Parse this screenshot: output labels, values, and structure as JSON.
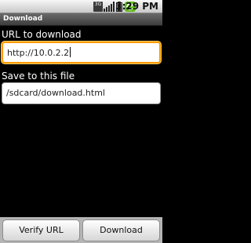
{
  "status_bar": {
    "network_label": "3G",
    "time": "3:29 PM"
  },
  "title_bar": {
    "title": "Download"
  },
  "form": {
    "url_label": "URL to download",
    "url_value": "http://10.0.2.2",
    "save_label": "Save to this file",
    "save_value": "/sdcard/download.html"
  },
  "buttons": {
    "verify_label": "Verify URL",
    "download_label": "Download"
  },
  "colors": {
    "focus_border": "#ff9a00",
    "sync_icon_green": "#5dbb1e"
  },
  "icons": [
    "3g-icon",
    "signal-icon",
    "battery-icon",
    "sync-icon"
  ]
}
